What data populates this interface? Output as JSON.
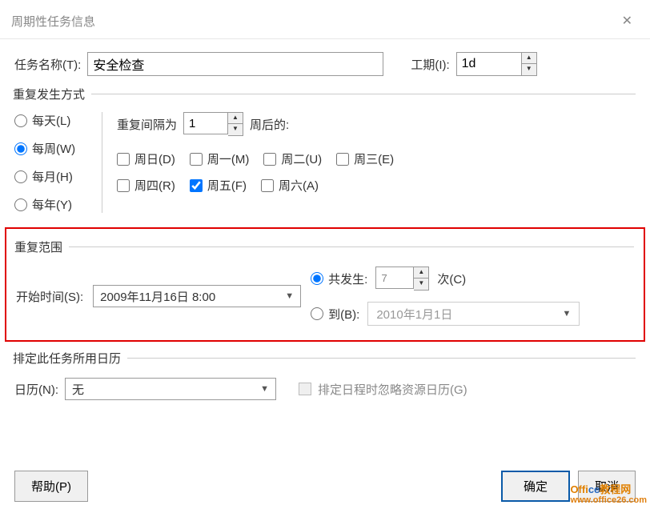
{
  "title": "周期性任务信息",
  "task": {
    "name_label": "任务名称(T):",
    "name_value": "安全检查",
    "duration_label": "工期(I):",
    "duration_value": "1d"
  },
  "recur": {
    "pattern_legend": "重复发生方式",
    "daily": "每天(L)",
    "weekly": "每周(W)",
    "monthly": "每月(H)",
    "yearly": "每年(Y)",
    "interval_label": "重复间隔为",
    "interval_value": "1",
    "interval_suffix": "周后的:",
    "sunday": "周日(D)",
    "monday": "周一(M)",
    "tuesday": "周二(U)",
    "wednesday": "周三(E)",
    "thursday": "周四(R)",
    "friday": "周五(F)",
    "saturday": "周六(A)"
  },
  "range": {
    "legend": "重复范围",
    "start_label": "开始时间(S):",
    "start_value": "2009年11月16日 8:00",
    "occur_label": "共发生:",
    "occur_value": "7",
    "occur_suffix": "次(C)",
    "end_by_label": "到(B):",
    "end_by_value": "2010年1月1日"
  },
  "calendar": {
    "legend": "排定此任务所用日历",
    "label": "日历(N):",
    "value": "无",
    "ignore_label": "排定日程时忽略资源日历(G)"
  },
  "buttons": {
    "help": "帮助(P)",
    "ok": "确定",
    "cancel": "取消"
  },
  "watermark": {
    "line1a": "Offi",
    "line1b": "ce",
    "line1c": "教程网",
    "line2": "www.office26.com"
  }
}
